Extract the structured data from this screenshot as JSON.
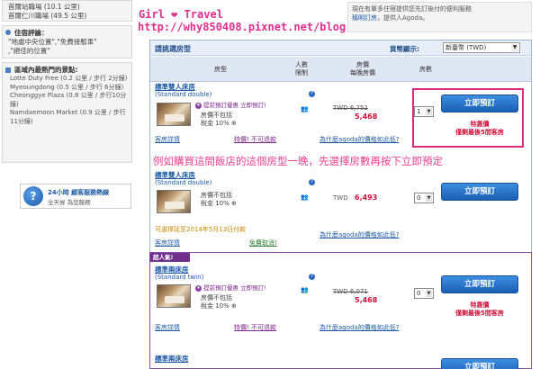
{
  "sidebar": {
    "top_lines": [
      "首爾站職場 (10.1 公里)",
      "首爾仁川職場 (49.5 公里)"
    ],
    "security_title": "住宿評論：",
    "security_lines": [
      "\"地處中央位置\",\"免費接駁車\"",
      ",\"絕佳的位置\""
    ],
    "landmarks_title": "區域內最熱門的景點:",
    "landmarks": [
      "Lotte Duty Free (0.2 公里 / 步行 2分鐘)",
      "Myeoungdong (0.5 公里 / 步行 6分鐘)",
      "Cheonggye Plaza (0.8 公里 / 步行10分鐘)",
      "Namdaemoon Market (0.9 公里 / 步行11分鐘)"
    ],
    "support": {
      "line1": "24小時 顧客服務熱線",
      "line2": "全天候 為您服務"
    }
  },
  "blog": {
    "title": "Girl  ❤  Travel",
    "url": "http://why850408.pixnet.net/blog"
  },
  "top_help": {
    "line1": "現在有單多住宿提供您先訂後付的便利服務",
    "link": "稱明訂房",
    "line2": "，提供人Agoda。"
  },
  "rooms_panel": {
    "title": "請挑選房型",
    "currency_label": "貨幣顯示:",
    "currency_value": "新臺幣 (TWD)",
    "columns": {
      "room_type": "房型",
      "occupancy_1": "人數",
      "occupancy_2": "限制",
      "price_1": "房價",
      "price_2": "每晚房價",
      "qty": "房數"
    }
  },
  "rows": [
    {
      "name": "標準雙人床房",
      "sub": "(Standard double)",
      "promo": "提前預訂優惠 立即預訂!",
      "feat1": "房價不包括",
      "feat2": "稅金 10% ⊕",
      "details": "客房詳情",
      "special": "特價! 不可退款",
      "price_old": "TWD 6,752",
      "price_new": "5,468",
      "why": "為什麼agoda的價格如此低?",
      "qty": "1",
      "book": "立即預訂",
      "note1": "特惠價",
      "note2": "僅剩最後5間客房"
    },
    {
      "name": "標準雙人床房",
      "sub": "(Standard double)",
      "feat1": "房價不包括",
      "feat2": "稅金 10% ⊕",
      "pay_later": "可選擇延至2014年5月13日付款",
      "details": "客房詳情",
      "cancel": "免費取消!",
      "price_old": "TWD",
      "price_new": "6,493",
      "why": "為什麼agoda的價格如此低?",
      "qty": "0",
      "book": "立即預訂"
    },
    {
      "hot": "超人氣!",
      "name": "標準兩床房",
      "sub": "(Standard twin)",
      "promo": "提前預訂優惠 立即預訂!",
      "feat1": "房價不包括",
      "feat2": "稅金 10% ⊕",
      "details": "客房詳情",
      "special": "特價! 不可退款",
      "price_old": "TWD 6,071",
      "price_new": "5,468",
      "why": "為什麼agoda的價格如此低?",
      "qty": "0",
      "book": "立即預訂",
      "note1": "特惠價",
      "note2": "僅剩最後5間客房"
    },
    {
      "name": "標準兩床房",
      "book": "立即預訂"
    }
  ],
  "annotation": "例如購買這間飯店的這個房型一晚，先選擇房數再按下立即預定"
}
